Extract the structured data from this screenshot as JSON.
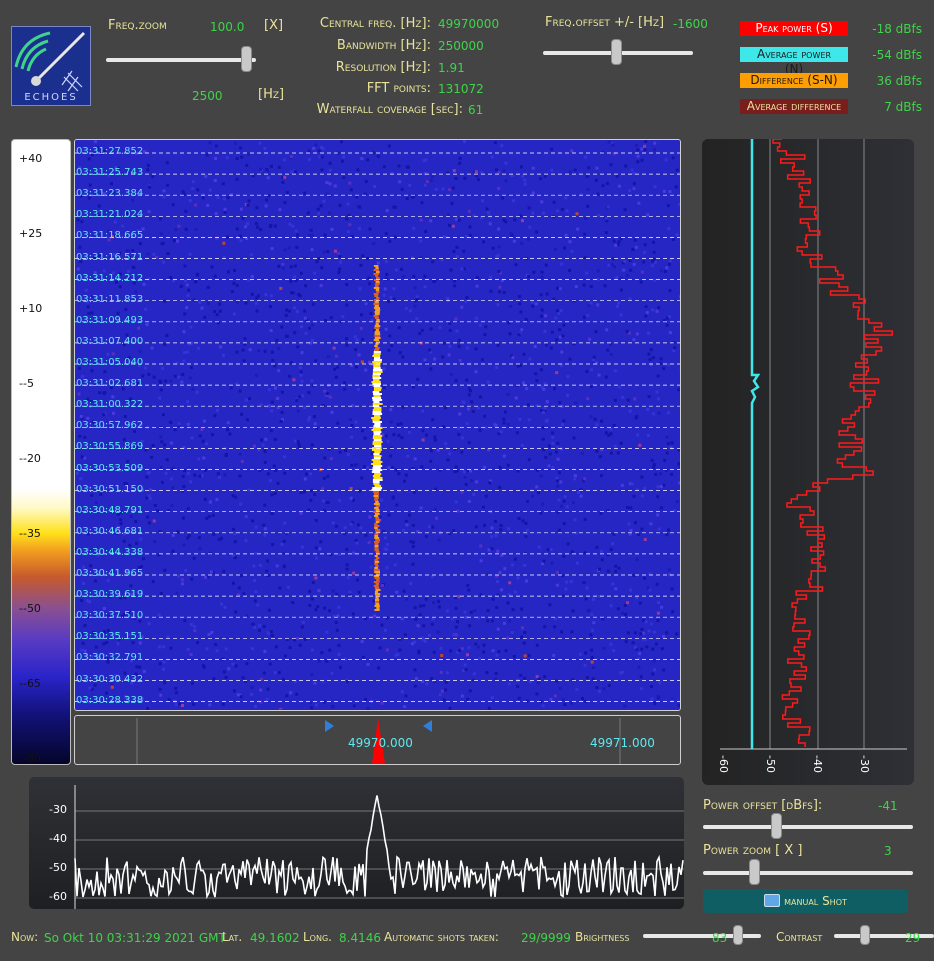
{
  "header": {
    "freq_zoom_label": "Freq.zoom",
    "freq_zoom_value": "100.0",
    "freq_zoom_unit": "[X]",
    "freq_span_value": "2500",
    "freq_span_unit": "[Hz]",
    "central_freq_label": "Central freq. [Hz]:",
    "central_freq_value": "49970000",
    "bandwidth_label": "Bandwidth [Hz]:",
    "bandwidth_value": "250000",
    "resolution_label": "Resolution [Hz]:",
    "resolution_value": "1.91",
    "fft_points_label": "FFT points:",
    "fft_points_value": "131072",
    "waterfall_label": "Waterfall coverage [sec]:",
    "waterfall_value": "61",
    "freq_offset_label": "Freq.offset +/- [Hz]",
    "freq_offset_value": "-1600"
  },
  "logo_text": "ECHOES",
  "legend": [
    {
      "label": "Peak power (S)",
      "value": "-18 dBfs",
      "bg": "#ff0000",
      "fg": "#ffffff"
    },
    {
      "label": "Average power (N)",
      "value": "-54 dBfs",
      "bg": "#3ee8ea",
      "fg": "#1a1a1a"
    },
    {
      "label": "Difference (S-N)",
      "value": "36 dBfs",
      "bg": "#ff9e00",
      "fg": "#1a1a1a"
    },
    {
      "label": "Average difference",
      "value": "7 dBfs",
      "bg": "#7a1d1d",
      "fg": "#e9e39b"
    }
  ],
  "colorbar_ticks": [
    "+40",
    "+25",
    "+10",
    "--5",
    "--20",
    "--35",
    "--50",
    "--65",
    "--80"
  ],
  "timestamps": [
    "03:31:27.852",
    "03:31:25.743",
    "03:31:23.384",
    "03:31:21.024",
    "03:31:18.665",
    "03:31:16.571",
    "03:31:14.212",
    "03:31:11.853",
    "03:31:09.493",
    "03:31:07.400",
    "03:31:05.040",
    "03:31:02.681",
    "03:31:00.322",
    "03:30:57.962",
    "03:30:55.869",
    "03:30:53.509",
    "03:30:51.150",
    "03:30:48.791",
    "03:30:46.681",
    "03:30:44.338",
    "03:30:41.965",
    "03:30:39.619",
    "03:30:37.510",
    "03:30:35.151",
    "03:30:32.791",
    "03:30:30.432",
    "03:30:28.338"
  ],
  "freq_axis": {
    "left_label": "49970.000",
    "right_label": "49971.000"
  },
  "power_axis_ticks": [
    "-60",
    "-50",
    "-40",
    "-30"
  ],
  "spectrum_y_ticks": [
    "-30",
    "-40",
    "-50",
    "-60"
  ],
  "controls": {
    "power_offset_label": "Power offset [dBfs]:",
    "power_offset_value": "-41",
    "power_zoom_label": "Power zoom [ X ]",
    "power_zoom_value": "3",
    "manual_shot_label": "manual Shot"
  },
  "status": {
    "now_label": "Now:",
    "now_value": "So Okt 10 03:31:29 2021 GMT",
    "lat_label": "Lat.",
    "lat_value": "49.1602",
    "long_label": "Long.",
    "long_value": "8.4146",
    "shots_label": "Automatic shots taken:",
    "shots_value": "29/9999",
    "brightness_label": "Brightness",
    "brightness_value": "83",
    "contrast_label": "Contrast",
    "contrast_value": "29"
  },
  "levels": {
    "freq_zoom_slider": 0.97,
    "freq_offset_slider": 0.49,
    "power_offset_slider": 0.34,
    "power_zoom_slider": 0.23,
    "brightness_slider": 0.83,
    "contrast_slider": 0.29
  }
}
